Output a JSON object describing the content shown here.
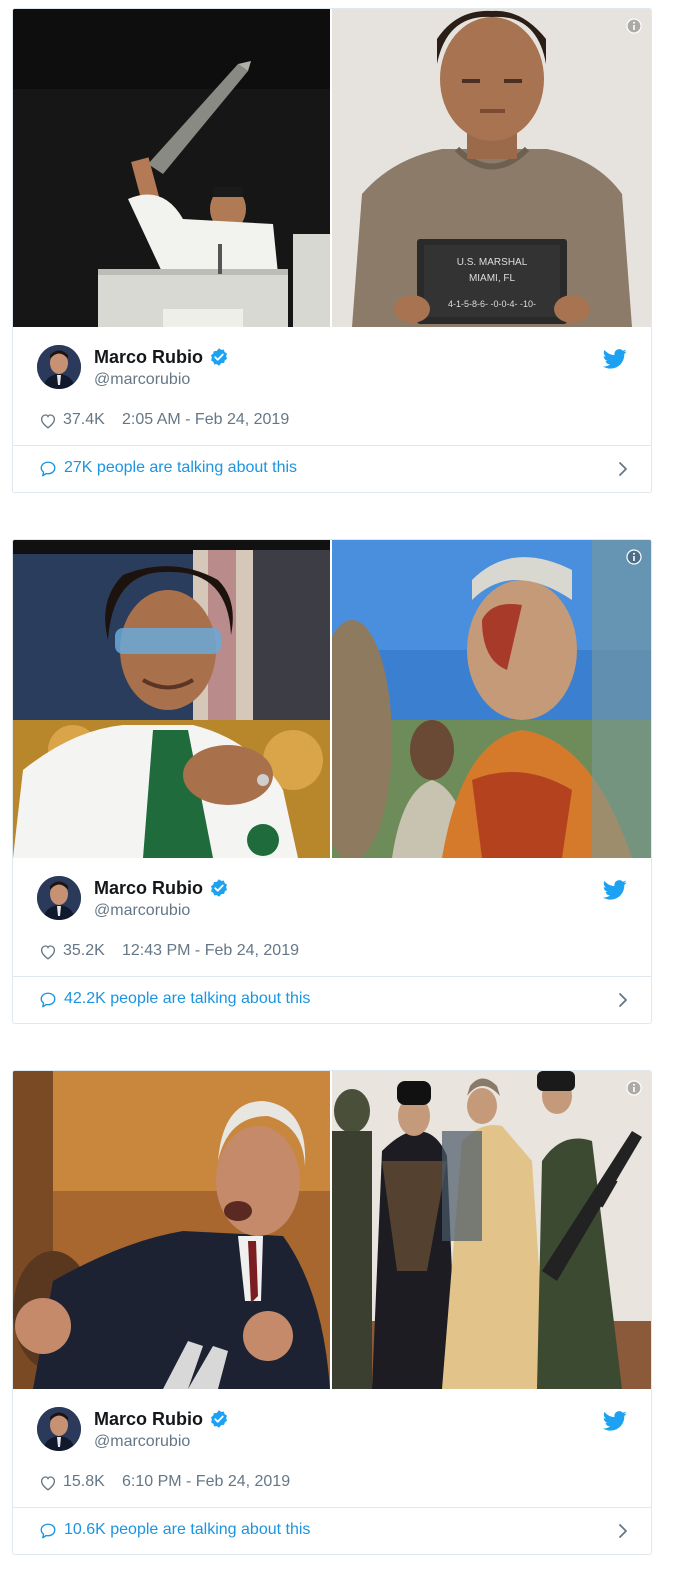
{
  "tweets": [
    {
      "author_name": "Marco Rubio",
      "author_handle": "@marcorubio",
      "likes": "37.4K",
      "timestamp": "2:05 AM - Feb 24, 2019",
      "talking": "27K people are talking about this",
      "mugshot_sign": {
        "line1": "U.S. MARSHAL",
        "line2": "MIAMI, FL",
        "line3": "4-1-5-8-6-  -0-0-4-  -10-"
      }
    },
    {
      "author_name": "Marco Rubio",
      "author_handle": "@marcorubio",
      "likes": "35.2K",
      "timestamp": "12:43 PM - Feb 24, 2019",
      "talking": "42.2K people are talking about this"
    },
    {
      "author_name": "Marco Rubio",
      "author_handle": "@marcorubio",
      "likes": "15.8K",
      "timestamp": "6:10 PM - Feb 24, 2019",
      "talking": "10.6K people are talking about this"
    }
  ],
  "colors": {
    "link_blue": "#1b95e0",
    "twitter_blue": "#1da1f2",
    "muted_gray": "#657786",
    "border": "#e1e8ed"
  },
  "icons": [
    "info-icon",
    "verified-badge-icon",
    "twitter-bird-icon",
    "heart-icon",
    "speech-bubble-icon",
    "chevron-right-icon"
  ]
}
